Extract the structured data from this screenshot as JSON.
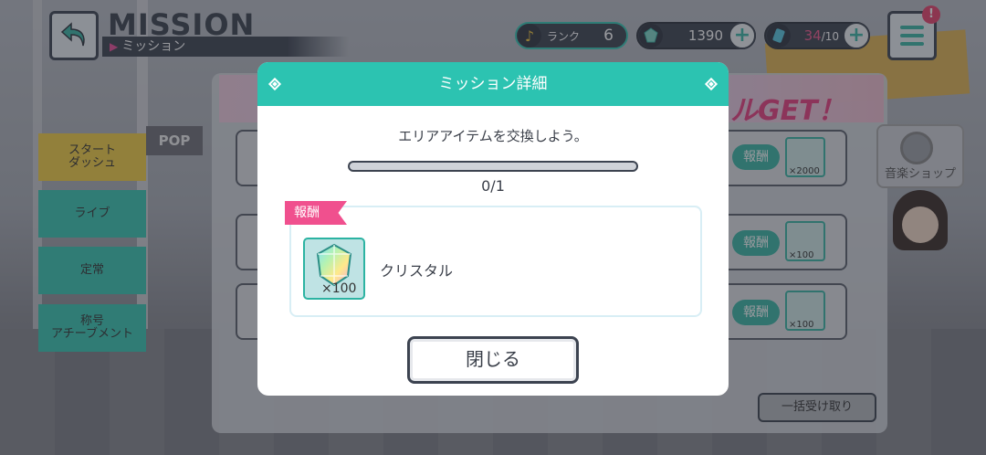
{
  "header": {
    "title": "MISSION",
    "subtitle": "ミッション",
    "rank_label": "ランク",
    "rank_value": "6",
    "crystals": "1390",
    "tickets_current": "34",
    "tickets_max": "/10",
    "alert_badge": "!"
  },
  "sidebar": {
    "items": [
      {
        "label": "スタート\nダッシュ"
      },
      {
        "label": "ライブ"
      },
      {
        "label": "定常"
      },
      {
        "label": "称号\nアチーブメント"
      }
    ]
  },
  "background": {
    "pop_sign": "POP",
    "banner_text": "ルGET！",
    "row_reward_label": "報酬",
    "rows": [
      {
        "qty": "×2000"
      },
      {
        "qty": "×100"
      },
      {
        "qty": "×100"
      }
    ],
    "bulk_receive": "一括受け取り",
    "music_shop": "音楽ショップ"
  },
  "modal": {
    "title": "ミッション詳細",
    "mission_text": "エリアアイテムを交換しよう。",
    "progress_current": 0,
    "progress_total": 1,
    "progress_text": "0/1",
    "reward_tag": "報酬",
    "reward_qty": "×100",
    "reward_name": "クリスタル",
    "close_label": "閉じる"
  },
  "colors": {
    "accent_teal": "#2cc3b1",
    "tag_pink": "#f0508e",
    "dark": "#3c4350"
  }
}
